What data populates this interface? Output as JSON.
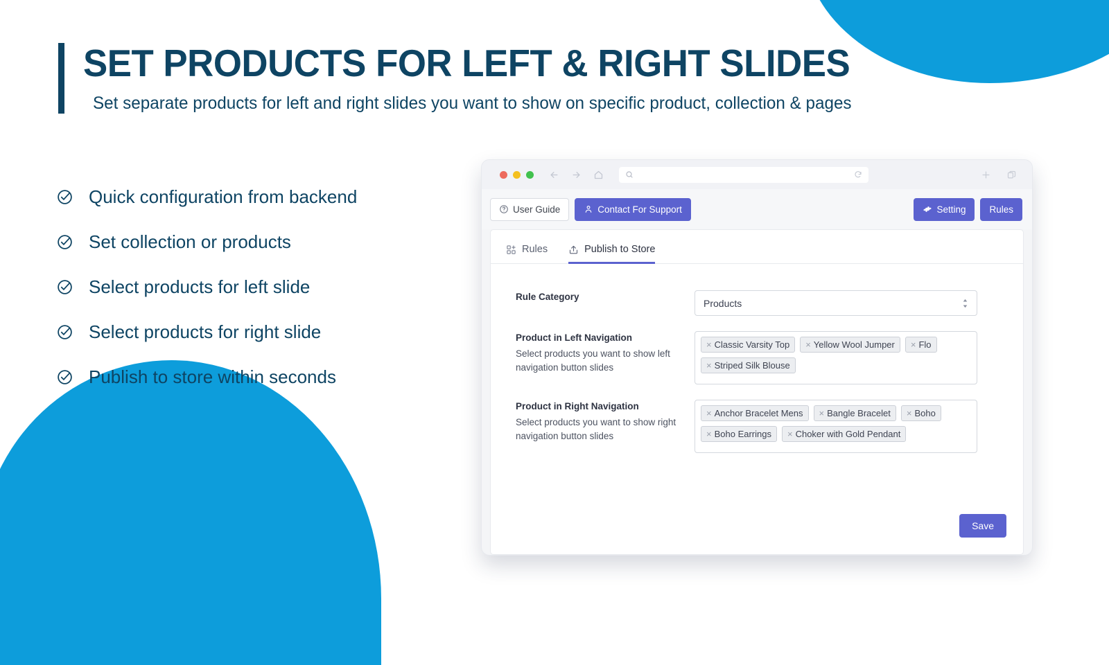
{
  "theme": {
    "navy": "#0e4463",
    "bright_blue": "#0d9ddb",
    "accent_purple": "#5b62cf"
  },
  "header": {
    "title": "SET PRODUCTS FOR LEFT & RIGHT SLIDES",
    "subtitle": "Set separate products for left and right slides you want to show on specific product, collection & pages"
  },
  "features": [
    {
      "icon": "check-circle-icon",
      "label": "Quick configuration from backend"
    },
    {
      "icon": "check-circle-icon",
      "label": "Set collection or products"
    },
    {
      "icon": "check-circle-icon",
      "label": "Select products for left slide"
    },
    {
      "icon": "check-circle-icon",
      "label": "Select products for right slide"
    },
    {
      "icon": "check-circle-icon",
      "label": "Publish to store within seconds"
    }
  ],
  "browser": {
    "traffic_lights": [
      "#ed6a5e",
      "#f4c020",
      "#41c14e"
    ],
    "back_icon": "arrow-left-icon",
    "forward_icon": "arrow-right-icon",
    "home_icon": "home-icon",
    "search_icon": "search-icon",
    "address_value": "",
    "address_placeholder": "",
    "reload_icon": "refresh-icon",
    "new_tab_icon": "plus-icon",
    "tabs_icon": "copy-window-icon"
  },
  "toolbar": {
    "user_guide": {
      "label": "User Guide",
      "icon": "question-circle-icon"
    },
    "contact_support": {
      "label": "Contact For Support",
      "icon": "person-icon"
    },
    "setting": {
      "label": "Setting",
      "icon": "gear-icon"
    },
    "rules": {
      "label": "Rules"
    }
  },
  "tabs": [
    {
      "label": "Rules",
      "icon": "grid-plus-icon",
      "active": false
    },
    {
      "label": "Publish to Store",
      "icon": "share-upload-icon",
      "active": true
    }
  ],
  "form": {
    "rule_category": {
      "label": "Rule Category",
      "value": "Products",
      "stepper_icon": "updown-stepper-icon"
    },
    "left_navigation": {
      "label": "Product in Left Navigation",
      "help": "Select products you want to show left navigation button slides",
      "tags_row1": [
        "Classic Varsity Top",
        "Yellow Wool Jumper",
        "Flo"
      ],
      "tags_row2": [
        "Striped Silk Blouse"
      ]
    },
    "right_navigation": {
      "label": "Product in Right Navigation",
      "help": "Select products you want to show right navigation button slides",
      "tags_row1": [
        "Anchor Bracelet Mens",
        "Bangle Bracelet",
        "Boho"
      ],
      "tags_row2": [
        "Boho Earrings",
        "Choker with Gold Pendant"
      ]
    },
    "remove_tag_glyph": "×",
    "save_label": "Save"
  }
}
